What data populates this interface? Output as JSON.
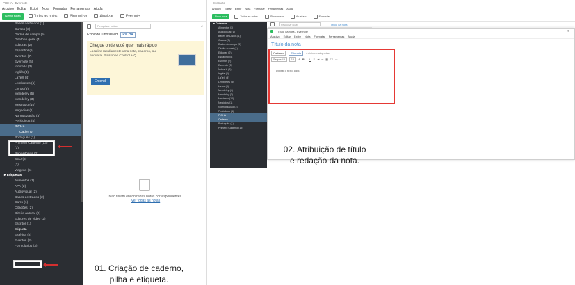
{
  "left": {
    "title": "PICHA - Evernote",
    "menu": [
      "Arquivo",
      "Editar",
      "Exibir",
      "Nota",
      "Formatar",
      "Ferramentas",
      "Ajuda"
    ],
    "toolbar": {
      "new_note": "Nova nota",
      "all_notes": "Todas as notas",
      "sync": "Sincronizar",
      "activity": "Atualizar",
      "evernote": "Evernote"
    },
    "sidebar": {
      "items_top": [
        "Bases de Dados (1)",
        "Cursos (3)",
        "Dados de campo (5)",
        "Diretório geral (4)",
        "Editoras (2)",
        "Espanhol (5)",
        "Eventos (7)",
        "Evernote (5)",
        "Índice H (3)",
        "Inglês (3)",
        "LaTeX (4)",
        "Lembretes (5)",
        "Livros (3)",
        "Mendeley (5)",
        "Mendeley (3)",
        "Mestrado (10)",
        "Negócios (1)",
        "Normatização (3)",
        "Periódicos (4)"
      ],
      "picha": "PICHA",
      "caderno": "Caderno",
      "items_mid": [
        "Português (1)",
        "Primeiro Caderno (13)"
      ],
      "items_mid2": [
        "(1)",
        "Repositórios (2)",
        "SEO (3)",
        "(2)",
        "Viagens (5)"
      ],
      "tags_header": "Etiquetas",
      "tags": [
        "Alimentos (1)",
        "APA (2)",
        "Audiovisual (2)",
        "Bases de Dados (2)",
        "Carro (1)",
        "Citações (2)",
        "Direito autoral (2)",
        "Editores de vídeo (2)",
        "Escritor (1)"
      ],
      "etiqueta": "Etiqueta",
      "tags_after": [
        "Estética (2)",
        "Eventos (2)",
        "Formulários (3)"
      ]
    },
    "notelist": {
      "search_placeholder": "Pesquisar todas",
      "showing": "Exibindo 0 notas em",
      "notebook_chip": "PICHA",
      "tip_title": "Chegue onde você quer mais rápido",
      "tip_body": "Localize rapidamente uma nota, caderno, ou etiqueta. Pressione Control + Q.",
      "tip_button": "Entendi",
      "empty_text": "Não foram encontradas notas correspondentes.",
      "empty_link": "Ver todas as notas"
    },
    "caption": [
      "01. Criação de caderno,",
      "pilha e etiqueta."
    ]
  },
  "right": {
    "title": "Evernote",
    "menu": [
      "Arquivo",
      "Editar",
      "Exibir",
      "Nota",
      "Formatar",
      "Ferramentas",
      "Ajuda"
    ],
    "toolbar": {
      "new_note": "Nova nota",
      "all_notes": "Todas as notas",
      "sync": "Sincronizar",
      "activity": "Atualizar",
      "evernote": "Evernote"
    },
    "sidebar_header": "Cadernos",
    "sidebar_items": [
      "Alimentos (1)",
      "Audiovisual (1)",
      "Bases de Dados (1)",
      "Cursos (3)",
      "Dados de campo (5)",
      "Direito autoral (1)",
      "Editoras (2)",
      "Espanhol (5)",
      "Eventos (7)",
      "Evernote (5)",
      "Índice H (3)",
      "Inglês (3)",
      "LaTeX (4)",
      "Lembretes (5)",
      "Livros (3)",
      "Mendeley (4)",
      "Mendeley (3)",
      "Mestrado (10)",
      "Negócios (1)",
      "Normatização (3)",
      "Periódicos (4)",
      "PICHA",
      "Caderno",
      "Português (1)",
      "Primeiro Caderno (13)"
    ],
    "search_placeholder": "Pesquisar notas",
    "breadcrumb": "Título da nota",
    "note_window": {
      "title": "Título da nota - Evernote",
      "menu": [
        "Arquivo",
        "Editar",
        "Exibir",
        "Nota",
        "Formatar",
        "Ferramentas",
        "Ajuda"
      ],
      "note_title": "Título da nota",
      "notebook_chip": "Caderno",
      "tag_chip": "Etiqueta",
      "add_tag": "Adicionar etiquetas",
      "font": "Segoe UI",
      "size": "10",
      "body": "Digitar o texto aqui."
    },
    "caption": [
      "02. Atribuição de título",
      "e redação da nota."
    ]
  },
  "colors": {
    "sidebar": "#2b2e33",
    "accent_green": "#2dbe60",
    "highlight_red": "#e53935",
    "note_title_blue": "#4a8fd0"
  }
}
